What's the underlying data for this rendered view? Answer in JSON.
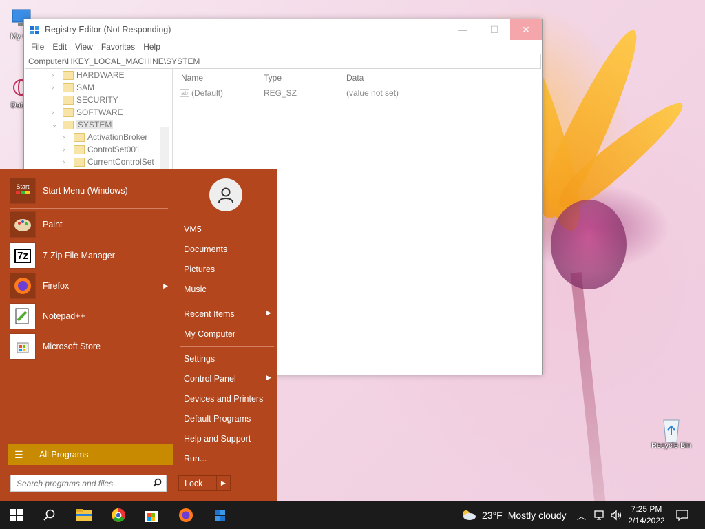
{
  "desktop": {
    "icons": [
      {
        "label": "My Co",
        "icon": "computer-icon"
      },
      {
        "label": "DataV",
        "icon": "datavis-icon"
      },
      {
        "label": "Recycle Bin",
        "icon": "recycle-bin-icon"
      }
    ]
  },
  "registry": {
    "title": "Registry Editor (Not Responding)",
    "menu": [
      "File",
      "Edit",
      "View",
      "Favorites",
      "Help"
    ],
    "address": "Computer\\HKEY_LOCAL_MACHINE\\SYSTEM",
    "tree": [
      {
        "label": "HARDWARE"
      },
      {
        "label": "SAM"
      },
      {
        "label": "SECURITY"
      },
      {
        "label": "SOFTWARE"
      },
      {
        "label": "SYSTEM"
      },
      {
        "label": "ActivationBroker"
      },
      {
        "label": "ControlSet001"
      },
      {
        "label": "CurrentControlSet"
      }
    ],
    "columns": [
      "Name",
      "Type",
      "Data"
    ],
    "rows": [
      {
        "name": "(Default)",
        "type": "REG_SZ",
        "data": "(value not set)"
      }
    ]
  },
  "start_menu": {
    "pinned": [
      {
        "label": "Start Menu (Windows)",
        "icon": "start-menu-icon"
      },
      {
        "label": "Paint",
        "icon": "paint-icon"
      },
      {
        "label": "7-Zip File Manager",
        "icon": "7zip-icon",
        "icon_text": "7z"
      },
      {
        "label": "Firefox",
        "icon": "firefox-icon"
      },
      {
        "label": "Notepad++",
        "icon": "notepadpp-icon"
      },
      {
        "label": "Microsoft Store",
        "icon": "store-icon"
      }
    ],
    "start_icon_text": "Start",
    "all_programs": "All Programs",
    "search_placeholder": "Search programs and files",
    "right_links": [
      {
        "label": "VM5"
      },
      {
        "label": "Documents"
      },
      {
        "label": "Pictures"
      },
      {
        "label": "Music"
      },
      {
        "label": "Recent Items"
      },
      {
        "label": "My Computer"
      },
      {
        "label": "Settings"
      },
      {
        "label": "Control Panel"
      },
      {
        "label": "Devices and Printers"
      },
      {
        "label": "Default Programs"
      },
      {
        "label": "Help and Support"
      },
      {
        "label": "Run..."
      }
    ],
    "lock": "Lock"
  },
  "taskbar": {
    "weather_temp": "23°F",
    "weather_desc": "Mostly cloudy",
    "time": "7:25 PM",
    "date": "2/14/2022"
  },
  "colors": {
    "start_menu_bg": "#b3461c",
    "all_programs_bg": "#c78a00",
    "taskbar_bg": "#1b1b1b"
  }
}
